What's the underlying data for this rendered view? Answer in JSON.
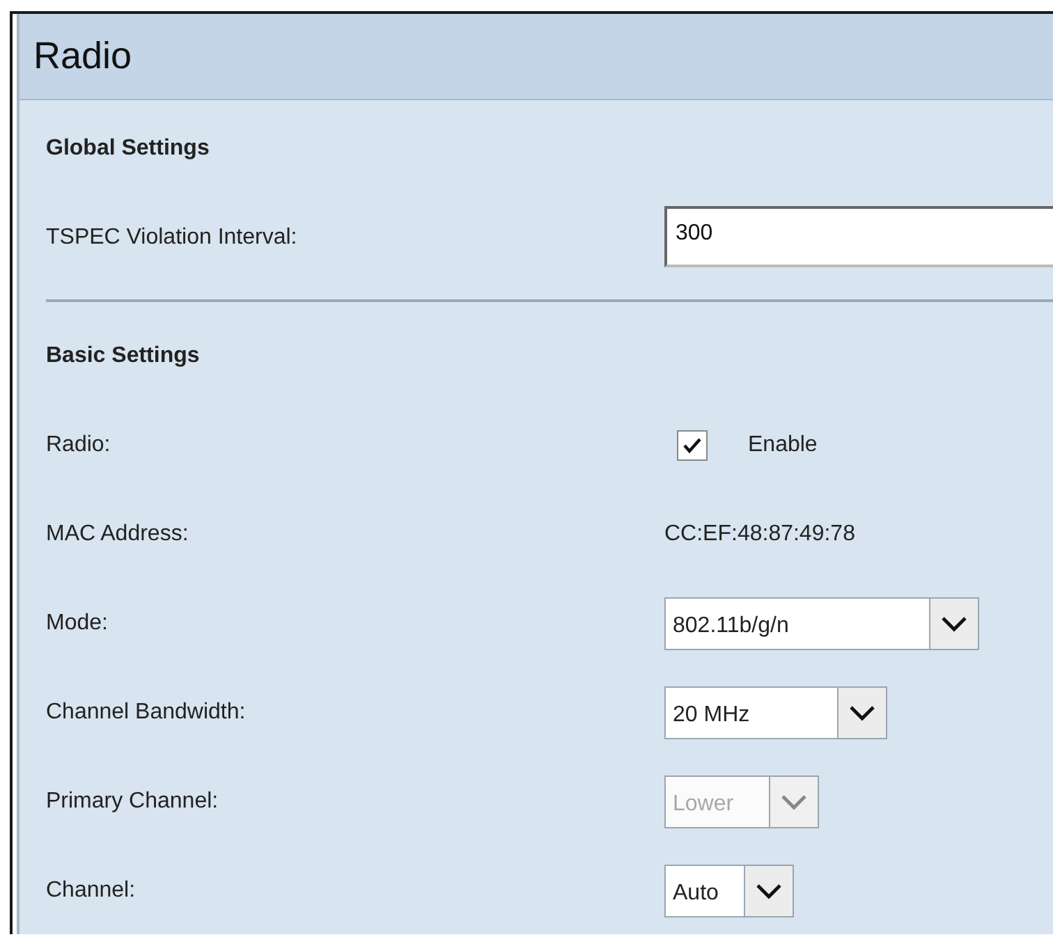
{
  "title": "Radio",
  "sections": [
    {
      "heading": "Global Settings",
      "rows": [
        {
          "label": "TSPEC Violation Interval:",
          "kind": "input",
          "value": "300"
        }
      ]
    },
    {
      "heading": "Basic Settings",
      "rows": [
        {
          "label": "Radio:",
          "kind": "checkbox",
          "checked": true,
          "text": "Enable"
        },
        {
          "label": "MAC Address:",
          "kind": "static",
          "value": "CC:EF:48:87:49:78"
        },
        {
          "label": "Mode:",
          "kind": "select",
          "value": "802.11b/g/n",
          "disabled": false
        },
        {
          "label": "Channel Bandwidth:",
          "kind": "select",
          "value": "20 MHz",
          "disabled": false
        },
        {
          "label": "Primary Channel:",
          "kind": "select",
          "value": "Lower",
          "disabled": true
        },
        {
          "label": "Channel:",
          "kind": "select",
          "value": "Auto",
          "disabled": false
        }
      ]
    }
  ]
}
